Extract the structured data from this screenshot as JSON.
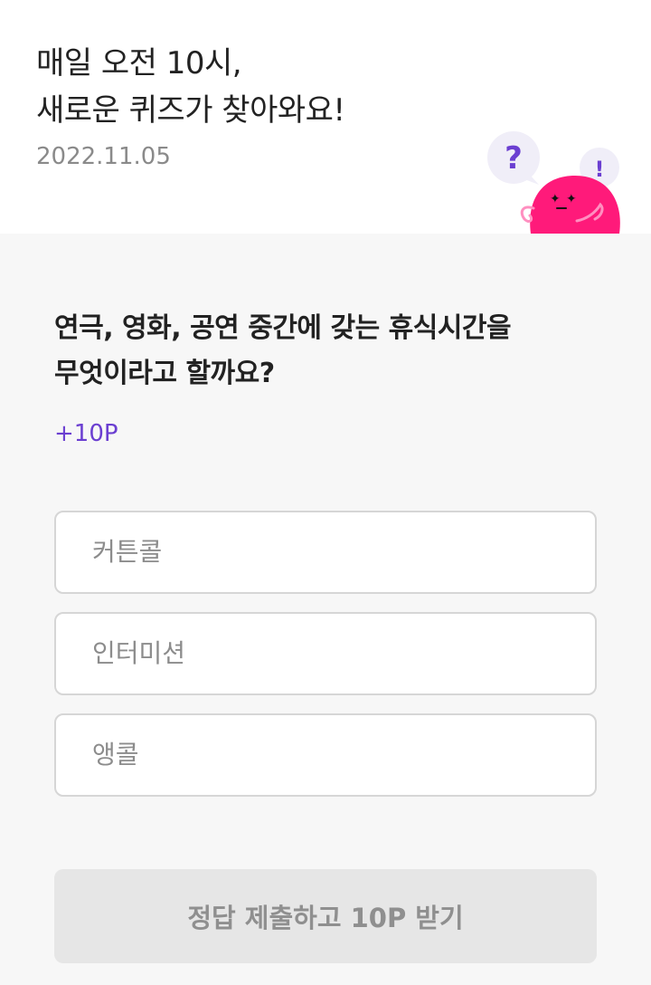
{
  "header": {
    "headline_line1": "매일 오전 10시,",
    "headline_line2": "새로운 퀴즈가 찾아와요!",
    "date": "2022.11.05"
  },
  "mascot": {
    "bubble_question": "?",
    "bubble_exclaim": "!",
    "body_color": "#ff1a7a",
    "accent_color": "#6b3fd1"
  },
  "quiz": {
    "question_line1": "연극, 영화, 공연 중간에 갖는 휴식시간을",
    "question_line2": "무엇이라고 할까요?",
    "points": "+10P",
    "options": [
      {
        "label": "커튼콜"
      },
      {
        "label": "인터미션"
      },
      {
        "label": "앵콜"
      }
    ],
    "submit_label": "정답 제출하고 10P 받기"
  }
}
